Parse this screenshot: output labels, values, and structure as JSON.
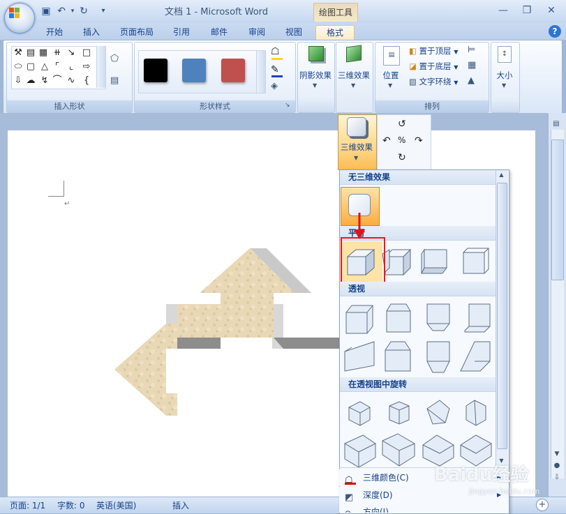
{
  "window": {
    "title": "文档 1 - Microsoft Word",
    "context_tab_title": "绘图工具"
  },
  "tabs": [
    "开始",
    "插入",
    "页面布局",
    "引用",
    "邮件",
    "审阅",
    "视图",
    "格式"
  ],
  "active_tab": "格式",
  "ribbon": {
    "groups": {
      "insert_shapes": "插入形状",
      "shape_styles": "形状样式",
      "arrange": "排列"
    },
    "style_swatches": [
      "#000000",
      "#4f81bd",
      "#c0504d"
    ],
    "buttons": {
      "shadow_effects": "阴影效果",
      "three_d_effects": "三维效果",
      "position": "位置",
      "size": "大小",
      "bring_to_front": "置于顶层",
      "send_to_back": "置于底层",
      "text_wrapping": "文字环绕"
    }
  },
  "dropdown": {
    "button_label": "三维效果",
    "sections": {
      "none": "无三维效果",
      "parallel": "平行",
      "perspective": "透视",
      "perspective_rotation": "在透视图中旋转"
    },
    "menu_items": {
      "color": "三维颜色(C)",
      "depth": "深度(D)",
      "direction": "方向(I)"
    }
  },
  "status_bar": {
    "page": "页面: 1/1",
    "words": "字数: 0",
    "language": "英语(美国)",
    "mode": "插入"
  },
  "watermark": {
    "text": "Baidu经验",
    "subtext": "jingyan.baidu.com"
  },
  "colors": {
    "accent_highlight": "#ff0000",
    "arrow_texture": "#e8d6b3",
    "ribbon_bg": "#dbe7f7"
  }
}
